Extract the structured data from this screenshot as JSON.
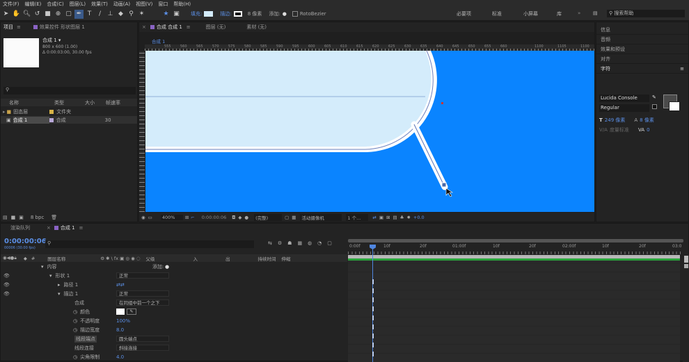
{
  "menu": [
    "文件(F)",
    "编辑(E)",
    "合成(C)",
    "图层(L)",
    "效果(T)",
    "动画(A)",
    "视图(V)",
    "窗口",
    "帮助(H)"
  ],
  "toolbar": {
    "fill": "填充:",
    "stroke": "描边:",
    "stroke_px": "8 像素",
    "add": "添加:",
    "rotobezier": "RotoBezier",
    "workspaces": [
      "必要项",
      "标准",
      "小屏幕",
      "库"
    ],
    "search": "搜索帮助"
  },
  "project": {
    "tab": "项目",
    "effects_tab": "效果控件 形状图层 1",
    "comp_name": "合成 1 ▾",
    "comp_info1": "800 x 600 (1.00)",
    "comp_info2": "Δ 0:00:03:00, 30.00 fps",
    "cols": [
      "名称",
      "类型",
      "大小",
      "帧速率"
    ],
    "rows": [
      {
        "name": "固态层",
        "type": "文件夹",
        "size": "",
        "fps": ""
      },
      {
        "name": "合成 1",
        "type": "合成",
        "size": "",
        "fps": "30"
      }
    ],
    "bpc": "8 bpc"
  },
  "viewer": {
    "tabs": [
      "合成 合成 1",
      "图层 (无)",
      "素材 (无)"
    ],
    "breadcrumb": "合成 1",
    "zoom": "400%",
    "timecode": "0:00:00:06",
    "quality": "(完整)",
    "camera": "活动摄像机",
    "views": "1 个...",
    "offset": "+0.0",
    "ruler": [
      "555",
      "560",
      "565",
      "570",
      "575",
      "580",
      "585",
      "590",
      "595",
      "600",
      "605",
      "610",
      "615",
      "620",
      "625",
      "630",
      "635",
      "640",
      "645",
      "650",
      "655",
      "660",
      "1100",
      "1105",
      "1100"
    ]
  },
  "right": {
    "items": [
      "信息",
      "音频",
      "效果和预设",
      "对齐"
    ],
    "char_title": "字符",
    "font": "Lucida Console",
    "style": "Regular",
    "size": "249 像素",
    "leading": "8 像素",
    "tracking": "度量标准",
    "vscale": "0"
  },
  "timeline": {
    "tabs": [
      "渲染队列",
      "合成 1"
    ],
    "timecode": "0:00:00:06",
    "frames": "00006 (30.00 fps)",
    "cols": [
      "图层名称",
      "父级",
      "入",
      "出",
      "持续时间",
      "伸缩"
    ],
    "ticks": [
      "0:00f",
      "10f",
      "20f",
      "01:00f",
      "10f",
      "20f",
      "02:00f",
      "10f",
      "20f",
      "03:0"
    ],
    "rows": [
      {
        "label": "内容",
        "indent": 1,
        "value": "",
        "add": "添加:"
      },
      {
        "label": "形状 1",
        "indent": 2,
        "value": "正常"
      },
      {
        "label": "路径 1",
        "indent": 3,
        "value": ""
      },
      {
        "label": "描边 1",
        "indent": 3,
        "value": "正常"
      },
      {
        "label": "合成",
        "indent": 4,
        "value": "在同组中前一个之下"
      },
      {
        "label": "颜色",
        "indent": 4,
        "value": ""
      },
      {
        "label": "不透明度",
        "indent": 4,
        "value": "100%"
      },
      {
        "label": "描边宽度",
        "indent": 4,
        "value": "8.0"
      },
      {
        "label": "线段端点",
        "indent": 4,
        "value": "圆头端点"
      },
      {
        "label": "线段连接",
        "indent": 4,
        "value": "斜接连接"
      },
      {
        "label": "尖角限制",
        "indent": 4,
        "value": "4.0"
      }
    ]
  },
  "colors": {
    "canvas": "#0a84ff",
    "fill": "#d4ecfb",
    "accent": "#5b8fe6"
  }
}
